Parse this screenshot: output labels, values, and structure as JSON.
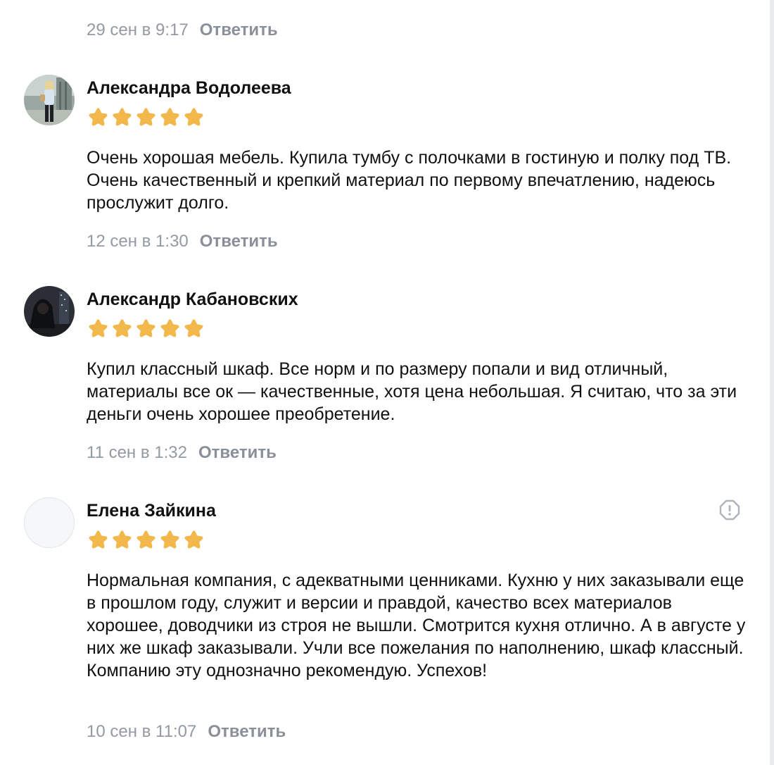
{
  "top_meta": {
    "date": "29 сен в 9:17",
    "reply": "Ответить"
  },
  "reviews": [
    {
      "author": "Александра Водолеева",
      "rating": 5,
      "text": "Очень хорошая мебель. Купила тумбу с полочками в гостиную и полку под ТВ. Очень качественный и крепкий материал по первому впечатлению, надеюсь прослужит долго.",
      "date": "12 сен в 1:30",
      "reply": "Ответить"
    },
    {
      "author": "Александр Кабановских",
      "rating": 5,
      "text": "Купил классный шкаф. Все норм и по размеру попали и вид отличный, материалы все ок — качественные, хотя цена небольшая. Я считаю, что за эти деньги очень хорошее преобретение.",
      "date": "11 сен в 1:32",
      "reply": "Ответить"
    },
    {
      "author": "Елена Зайкина",
      "rating": 5,
      "text": "Нормальная компания, с адекватными ценниками. Кухню у них заказывали еще в прошлом году, служит и версии и правдой, качество всех материалов хорошее, доводчики из строя не вышли. Смотрится кухня отлично. А в августе у них же шкаф заказывали. Учли все пожелания по наполнению, шкаф классный. Компанию эту однозначно рекомендую. Успехов!",
      "date": "10 сен в 11:07",
      "reply": "Ответить"
    }
  ],
  "colors": {
    "star": "#f2b84b",
    "meta_text": "#939aa3",
    "report_icon": "#aeb4bc"
  },
  "icons": {
    "star": "star-icon",
    "report": "report-icon"
  }
}
